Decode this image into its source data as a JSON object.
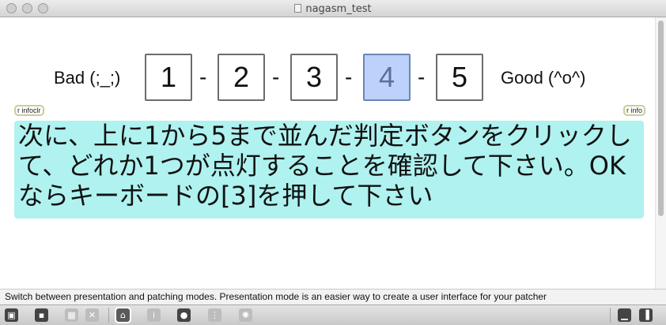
{
  "window": {
    "title": "nagasm_test"
  },
  "rating": {
    "bad_label": "Bad (;_;)",
    "good_label": "Good (^o^)",
    "buttons": [
      "1",
      "2",
      "3",
      "4",
      "5"
    ],
    "separator": "-",
    "lit_button_value": 4,
    "lit_color": "#bcd2fa"
  },
  "receivers": {
    "left": "r infoclr",
    "right": "r info"
  },
  "message": {
    "text": "次に、上に1から5まで並んだ判定ボタンをクリックして、どれか1つが点灯することを確認して下さい。OKならキーボードの[3]を押して下さい",
    "background": "#aff2f0"
  },
  "status_bar": {
    "text": "Switch between presentation and patching modes. Presentation mode is an easier way to create a user interface for your patcher"
  },
  "toolbar": {
    "icons": [
      "lock-icon",
      "new-object-icon",
      "object-palette-icon",
      "close-box-icon",
      "presentation-mode-icon",
      "inspector-icon",
      "debug-icon",
      "grid-icon",
      "settings-icon",
      "patcher-window-icon",
      "sidebar-icon"
    ]
  }
}
